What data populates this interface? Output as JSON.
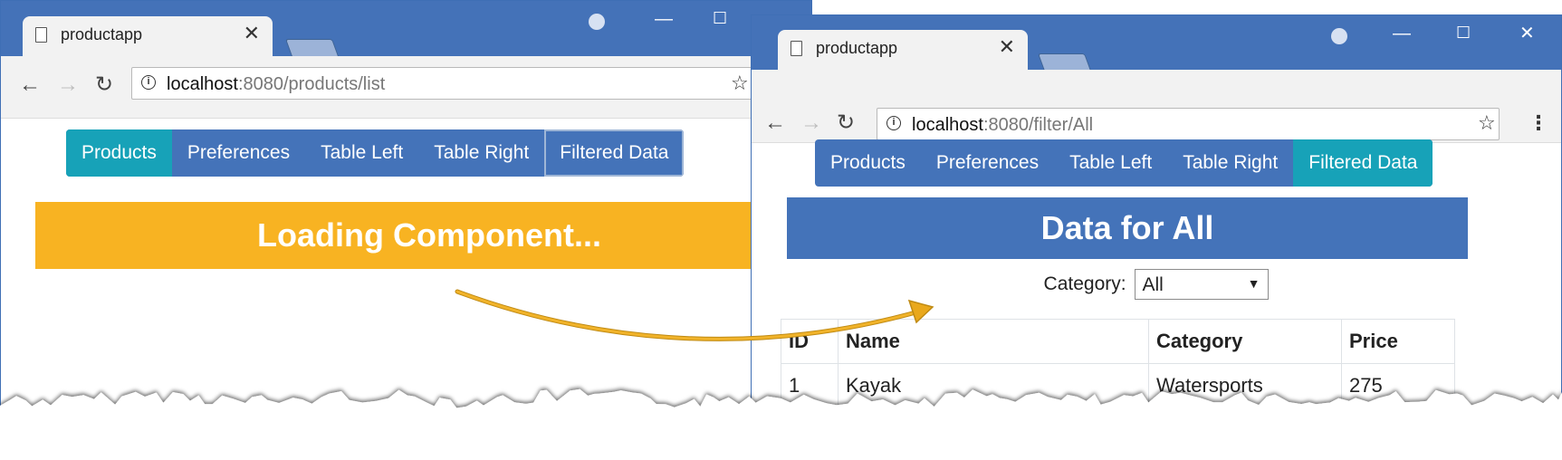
{
  "window_left": {
    "tab_title": "productapp",
    "url_host": "localhost",
    "url_path": ":8080/products/list",
    "nav_buttons": [
      "Products",
      "Preferences",
      "Table Left",
      "Table Right",
      "Filtered Data"
    ],
    "active_index": 0,
    "banner_text": "Loading Component...",
    "banner_color": "#f8b322"
  },
  "window_right": {
    "tab_title": "productapp",
    "url_host": "localhost",
    "url_path": ":8080/filter/All",
    "nav_buttons": [
      "Products",
      "Preferences",
      "Table Left",
      "Table Right",
      "Filtered Data"
    ],
    "active_index": 4,
    "banner_text": "Data for All",
    "banner_color": "#4473b9",
    "category_label": "Category:",
    "category_selected": "All",
    "table": {
      "headers": [
        "ID",
        "Name",
        "Category",
        "Price"
      ],
      "rows": [
        [
          "1",
          "Kayak",
          "Watersports",
          "275"
        ]
      ]
    }
  },
  "colors": {
    "titlebar": "#4472b8",
    "nav_bg": "#4473b9",
    "nav_active": "#17a2b8",
    "arrow": "#e9a81c"
  }
}
